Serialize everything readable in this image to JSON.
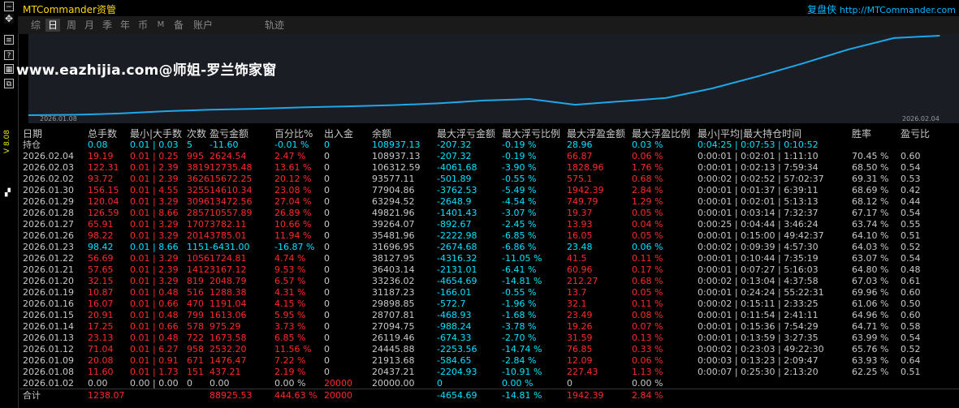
{
  "titlebar": {
    "title": "MTCommander资管",
    "brand_name": "复盘侠",
    "brand_url": "http://MTCommander.com"
  },
  "leftbar": {
    "vlabel": "V 8.08"
  },
  "tabs": [
    {
      "label": "综",
      "active": false
    },
    {
      "label": "日",
      "active": true
    },
    {
      "label": "周",
      "active": false
    },
    {
      "label": "月",
      "active": false
    },
    {
      "label": "季",
      "active": false
    },
    {
      "label": "年",
      "active": false
    },
    {
      "label": "币",
      "active": false
    },
    {
      "label": "M",
      "active": false
    },
    {
      "label": "备",
      "active": false
    },
    {
      "label": "账户",
      "active": false
    },
    {
      "label": "轨迹",
      "active": false
    }
  ],
  "watermark": "www.eazhijia.com@师姐-罗兰饰家窗",
  "chart_data": {
    "type": "line",
    "x_start_label": "2026.01.08",
    "x_end_label": "2026.02.04",
    "x": [
      "2026.01.02",
      "2026.01.08",
      "2026.01.09",
      "2026.01.12",
      "2026.01.13",
      "2026.01.14",
      "2026.01.15",
      "2026.01.16",
      "2026.01.19",
      "2026.01.20",
      "2026.01.21",
      "2026.01.22",
      "2026.01.23",
      "2026.01.26",
      "2026.01.27",
      "2026.01.28",
      "2026.01.29",
      "2026.01.30",
      "2026.02.02",
      "2026.02.03",
      "2026.02.04"
    ],
    "values": [
      20000.0,
      20437.21,
      21913.68,
      24445.88,
      26119.46,
      27094.75,
      28707.81,
      29898.85,
      31187.23,
      33236.02,
      36403.14,
      38127.95,
      31696.95,
      35481.96,
      39264.07,
      49821.96,
      63294.52,
      77904.86,
      93577.11,
      106312.59,
      108937.13
    ],
    "color": "#1ea8e8"
  },
  "table": {
    "headers": [
      "日期",
      "总手数",
      "最小|大手数",
      "次数",
      "盈亏金额",
      "百分比%",
      "出入金",
      "余额",
      "最大浮亏金额",
      "最大浮亏比例",
      "最大浮盈金额",
      "最大浮盈比例",
      "最小|平均|最大持仓时间",
      "胜率",
      "盈亏比"
    ],
    "hold_row": [
      "持仓",
      "0.08",
      "0.01 | 0.03",
      "5",
      "-11.60",
      "-0.01 %",
      "0",
      "108937.13",
      "-207.32",
      "-0.19 %",
      "28.96",
      "0.03 %",
      "0:04:25 | 0:07:53 | 0:10:52",
      "",
      ""
    ],
    "rows": [
      {
        "cls": "r",
        "v": [
          "2026.02.04",
          "19.19",
          "0.01 | 0.25",
          "995",
          "2624.54",
          "2.47 %",
          "0",
          "108937.13",
          "-207.32",
          "-0.19 %",
          "66.87",
          "0.06 %",
          "0:00:01 | 0:02:01 | 1:11:10",
          "70.45 %",
          "0.60"
        ]
      },
      {
        "cls": "r",
        "v": [
          "2026.02.03",
          "122.31",
          "0.01 | 2.39",
          "3819",
          "12735.48",
          "13.61 %",
          "0",
          "106312.59",
          "-4061.68",
          "-3.90 %",
          "1828.96",
          "1.76 %",
          "0:00:01 | 0:02:13 | 7:59:34",
          "68.50 %",
          "0.54"
        ]
      },
      {
        "cls": "r",
        "v": [
          "2026.02.02",
          "93.72",
          "0.01 | 2.39",
          "3626",
          "15672.25",
          "20.12 %",
          "0",
          "93577.11",
          "-501.89",
          "-0.55 %",
          "575.1",
          "0.68 %",
          "0:00:02 | 0:02:52 | 57:02:37",
          "69.31 %",
          "0.53"
        ]
      },
      {
        "cls": "r",
        "v": [
          "2026.01.30",
          "156.15",
          "0.01 | 4.55",
          "3255",
          "14610.34",
          "23.08 %",
          "0",
          "77904.86",
          "-3762.53",
          "-5.49 %",
          "1942.39",
          "2.84 %",
          "0:00:01 | 0:01:37 | 6:39:11",
          "68.69 %",
          "0.42"
        ]
      },
      {
        "cls": "r",
        "v": [
          "2026.01.29",
          "120.04",
          "0.01 | 3.29",
          "3096",
          "13472.56",
          "27.04 %",
          "0",
          "63294.52",
          "-2648.9",
          "-4.54 %",
          "749.79",
          "1.29 %",
          "0:00:01 | 0:02:01 | 5:13:13",
          "68.12 %",
          "0.44"
        ]
      },
      {
        "cls": "r",
        "v": [
          "2026.01.28",
          "126.59",
          "0.01 | 8.66",
          "2857",
          "10557.89",
          "26.89 %",
          "0",
          "49821.96",
          "-1401.43",
          "-3.07 %",
          "19.37",
          "0.05 %",
          "0:00:01 | 0:03:14 | 7:32:37",
          "67.17 %",
          "0.54"
        ]
      },
      {
        "cls": "r",
        "v": [
          "2026.01.27",
          "65.91",
          "0.01 | 3.29",
          "1707",
          "3782.11",
          "10.66 %",
          "0",
          "39264.07",
          "-892.67",
          "-2.45 %",
          "13.93",
          "0.04 %",
          "0:00:25 | 0:04:44 | 3:46:24",
          "63.74 %",
          "0.55"
        ]
      },
      {
        "cls": "r",
        "v": [
          "2026.01.26",
          "98.22",
          "0.01 | 3.29",
          "2014",
          "3785.01",
          "11.94 %",
          "0",
          "35481.96",
          "-2222.98",
          "-6.85 %",
          "16.05",
          "0.05 %",
          "0:00:01 | 0:15:00 | 49:42:37",
          "64.10 %",
          "0.51"
        ]
      },
      {
        "cls": "c",
        "v": [
          "2026.01.23",
          "98.42",
          "0.01 | 8.66",
          "1151",
          "-6431.00",
          "-16.87 %",
          "0",
          "31696.95",
          "-2674.68",
          "-6.86 %",
          "23.48",
          "0.06 %",
          "0:00:02 | 0:09:39 | 4:57:30",
          "64.03 %",
          "0.52"
        ]
      },
      {
        "cls": "r",
        "v": [
          "2026.01.22",
          "56.69",
          "0.01 | 3.29",
          "1056",
          "1724.81",
          "4.74 %",
          "0",
          "38127.95",
          "-4316.32",
          "-11.05 %",
          "41.5",
          "0.11 %",
          "0:00:01 | 0:10:44 | 7:35:19",
          "63.07 %",
          "0.54"
        ]
      },
      {
        "cls": "r",
        "v": [
          "2026.01.21",
          "57.65",
          "0.01 | 2.39",
          "1412",
          "3167.12",
          "9.53 %",
          "0",
          "36403.14",
          "-2131.01",
          "-6.41 %",
          "60.96",
          "0.17 %",
          "0:00:01 | 0:07:27 | 5:16:03",
          "64.80 %",
          "0.48"
        ]
      },
      {
        "cls": "r",
        "v": [
          "2026.01.20",
          "32.15",
          "0.01 | 3.29",
          "819",
          "2048.79",
          "6.57 %",
          "0",
          "33236.02",
          "-4654.69",
          "-14.81 %",
          "212.27",
          "0.68 %",
          "0:00:02 | 0:13:04 | 4:37:58",
          "67.03 %",
          "0.61"
        ]
      },
      {
        "cls": "r",
        "v": [
          "2026.01.19",
          "10.87",
          "0.01 | 0.48",
          "516",
          "1288.38",
          "4.31 %",
          "0",
          "31187.23",
          "-166.01",
          "-0.55 %",
          "13.7",
          "0.05 %",
          "0:00:01 | 0:24:24 | 55:22:31",
          "69.96 %",
          "0.60"
        ]
      },
      {
        "cls": "r",
        "v": [
          "2026.01.16",
          "16.07",
          "0.01 | 0.66",
          "470",
          "1191.04",
          "4.15 %",
          "0",
          "29898.85",
          "-572.7",
          "-1.96 %",
          "32.1",
          "0.11 %",
          "0:00:02 | 0:15:11 | 2:33:25",
          "61.06 %",
          "0.50"
        ]
      },
      {
        "cls": "r",
        "v": [
          "2026.01.15",
          "20.91",
          "0.01 | 0.48",
          "799",
          "1613.06",
          "5.95 %",
          "0",
          "28707.81",
          "-468.93",
          "-1.68 %",
          "23.49",
          "0.08 %",
          "0:00:01 | 0:11:54 | 2:41:11",
          "64.96 %",
          "0.60"
        ]
      },
      {
        "cls": "r",
        "v": [
          "2026.01.14",
          "17.25",
          "0.01 | 0.66",
          "578",
          "975.29",
          "3.73 %",
          "0",
          "27094.75",
          "-988.24",
          "-3.78 %",
          "19.26",
          "0.07 %",
          "0:00:01 | 0:15:36 | 7:54:29",
          "64.71 %",
          "0.58"
        ]
      },
      {
        "cls": "r",
        "v": [
          "2026.01.13",
          "23.13",
          "0.01 | 0.48",
          "722",
          "1673.58",
          "6.85 %",
          "0",
          "26119.46",
          "-674.33",
          "-2.70 %",
          "31.59",
          "0.13 %",
          "0:00:01 | 0:13:59 | 3:27:35",
          "63.99 %",
          "0.54"
        ]
      },
      {
        "cls": "r",
        "v": [
          "2026.01.12",
          "71.04",
          "0.01 | 6.27",
          "958",
          "2532.20",
          "11.56 %",
          "0",
          "24445.88",
          "-2253.56",
          "-14.74 %",
          "76.85",
          "0.33 %",
          "0:00:02 | 0:23:03 | 49:22:30",
          "65.76 %",
          "0.52"
        ]
      },
      {
        "cls": "r",
        "v": [
          "2026.01.09",
          "20.08",
          "0.01 | 0.91",
          "671",
          "1476.47",
          "7.22 %",
          "0",
          "21913.68",
          "-584.65",
          "-2.84 %",
          "12.09",
          "0.06 %",
          "0:00:03 | 0:13:23 | 2:09:47",
          "63.93 %",
          "0.64"
        ]
      },
      {
        "cls": "r",
        "v": [
          "2026.01.08",
          "11.60",
          "0.01 | 1.73",
          "151",
          "437.21",
          "2.19 %",
          "0",
          "20437.21",
          "-2204.93",
          "-10.91 %",
          "227.43",
          "1.13 %",
          "0:00:07 | 0:25:30 | 2:13:20",
          "62.25 %",
          "0.51"
        ]
      },
      {
        "cls": "g",
        "v": [
          "2026.01.02",
          "0.00",
          "0.00 | 0.00",
          "0",
          "0.00",
          "0.00 %",
          "20000",
          "20000.00",
          "0",
          "0.00 %",
          "0",
          "0.00 %",
          "",
          "",
          ""
        ]
      }
    ],
    "total_row": [
      "合计",
      "1238.07",
      "",
      "",
      "88925.53",
      "444.63 %",
      "20000",
      "",
      "-4654.69",
      "-14.81 %",
      "1942.39",
      "2.84 %",
      "",
      "",
      ""
    ]
  }
}
